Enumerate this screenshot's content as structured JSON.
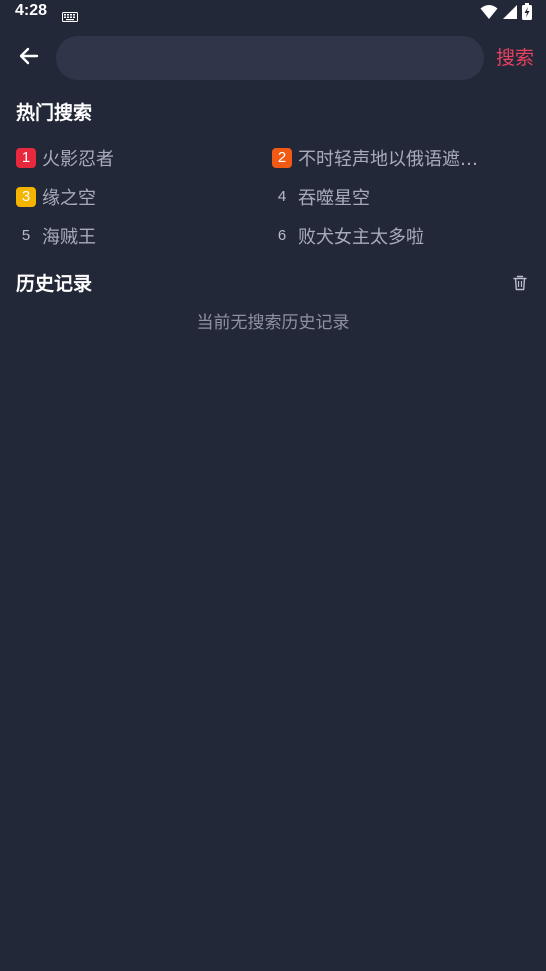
{
  "status_bar": {
    "time": "4:28",
    "icons": [
      "keyboard-icon",
      "wifi-icon",
      "cellular-signal-icon",
      "battery-charging-icon"
    ]
  },
  "search": {
    "back_icon": "arrow-left-icon",
    "value": "",
    "button_label": "搜索"
  },
  "hot_search": {
    "title": "热门搜索",
    "items": [
      {
        "rank": "1",
        "label": "火影忍者",
        "badge_color": "#e8283c"
      },
      {
        "rank": "2",
        "label": "不时轻声地以俄语遮…",
        "badge_color": "#f05a14"
      },
      {
        "rank": "3",
        "label": "缘之空",
        "badge_color": "#f5b400"
      },
      {
        "rank": "4",
        "label": "吞噬星空",
        "badge_color": null
      },
      {
        "rank": "5",
        "label": "海贼王",
        "badge_color": null
      },
      {
        "rank": "6",
        "label": "败犬女主太多啦",
        "badge_color": null
      }
    ]
  },
  "history": {
    "title": "历史记录",
    "clear_icon": "trash-icon",
    "empty_message": "当前无搜索历史记录"
  },
  "colors": {
    "background": "#232838",
    "search_field": "#30364a",
    "accent": "#e8415f"
  }
}
